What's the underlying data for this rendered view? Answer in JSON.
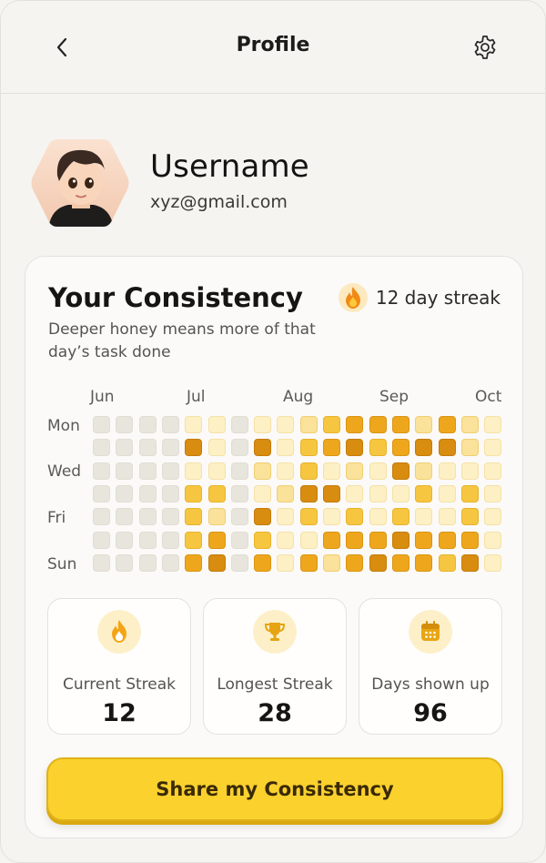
{
  "header": {
    "title": "Profile",
    "back_icon": "chevron-left-icon",
    "settings_icon": "gear-icon"
  },
  "profile": {
    "username": "Username",
    "email": "xyz@gmail.com"
  },
  "consistency": {
    "title": "Your Consistency",
    "subtitle": "Deeper honey means more of that day’s task done",
    "streak_label": "12 day streak",
    "months": [
      "Jun",
      "Jul",
      "Aug",
      "Sep",
      "Oct"
    ],
    "weekday_labels": [
      "Mon",
      "Wed",
      "Fri",
      "Sun"
    ],
    "level_colors": [
      "#e8e5dd",
      "#fdf0c5",
      "#fbe29a",
      "#f6c641",
      "#eea71d",
      "#d88c10"
    ],
    "levels": [
      [
        0,
        0,
        0,
        0,
        1,
        1,
        0,
        1,
        1,
        2,
        3,
        4,
        4,
        4,
        2,
        4,
        2,
        1
      ],
      [
        0,
        0,
        0,
        0,
        5,
        1,
        0,
        5,
        1,
        3,
        4,
        5,
        3,
        4,
        5,
        5,
        2,
        1
      ],
      [
        0,
        0,
        0,
        0,
        1,
        1,
        0,
        2,
        1,
        3,
        1,
        2,
        1,
        5,
        2,
        1,
        1,
        1
      ],
      [
        0,
        0,
        0,
        0,
        3,
        3,
        0,
        1,
        2,
        5,
        5,
        1,
        1,
        1,
        3,
        1,
        3,
        1
      ],
      [
        0,
        0,
        0,
        0,
        3,
        2,
        0,
        5,
        1,
        3,
        1,
        3,
        1,
        3,
        1,
        1,
        3,
        1
      ],
      [
        0,
        0,
        0,
        0,
        3,
        4,
        0,
        3,
        1,
        1,
        4,
        4,
        4,
        5,
        4,
        4,
        4,
        1
      ],
      [
        0,
        0,
        0,
        0,
        4,
        5,
        0,
        4,
        1,
        4,
        2,
        4,
        5,
        4,
        4,
        3,
        5,
        1
      ]
    ]
  },
  "stats": [
    {
      "label": "Current Streak",
      "value": "12",
      "icon": "flame-icon"
    },
    {
      "label": "Longest Streak",
      "value": "28",
      "icon": "trophy-icon"
    },
    {
      "label": "Days shown up",
      "value": "96",
      "icon": "calendar-icon"
    }
  ],
  "share_button": "Share my Consistency",
  "colors": {
    "accent": "#fbd12e",
    "honey_dark": "#d88c10",
    "background": "#f5f4f1",
    "card": "#fbfaf8"
  }
}
